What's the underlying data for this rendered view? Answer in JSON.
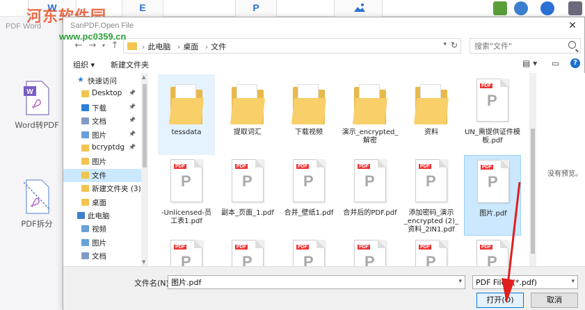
{
  "watermark": {
    "site": "河东软件园",
    "url": "www.pc0359.cn"
  },
  "background_app": {
    "brand": "PDF Word",
    "toolbar_glyphs": [
      "W",
      "E",
      "P"
    ],
    "side_items": [
      {
        "label": "Word转PDF"
      },
      {
        "label": "PDF拆分"
      }
    ]
  },
  "dialog": {
    "title": "SanPDF.Open File",
    "close": "✕",
    "address": {
      "crumbs": [
        "此电脑",
        "桌面",
        "文件"
      ],
      "search_placeholder": "搜索\"文件\""
    },
    "toolbar": {
      "organize": "组织 ▾",
      "new_folder": "新建文件夹",
      "help": "?"
    },
    "nav_pane": [
      {
        "label": "快速访问",
        "kind": "star"
      },
      {
        "label": "Desktop",
        "kind": "folder",
        "pinned": true
      },
      {
        "label": "下载",
        "kind": "download",
        "pinned": true
      },
      {
        "label": "文档",
        "kind": "doc",
        "pinned": true
      },
      {
        "label": "图片",
        "kind": "pic",
        "pinned": true
      },
      {
        "label": "bcryptdg",
        "kind": "folder",
        "pinned": true
      },
      {
        "label": "图片",
        "kind": "folder"
      },
      {
        "label": "文件",
        "kind": "folder",
        "selected": true
      },
      {
        "label": "新建文件夹 (3)",
        "kind": "folder"
      },
      {
        "label": "桌面",
        "kind": "folder"
      },
      {
        "label": "此电脑",
        "kind": "pc"
      },
      {
        "label": "视频",
        "kind": "pic"
      },
      {
        "label": "图片",
        "kind": "pic"
      },
      {
        "label": "文档",
        "kind": "doc"
      }
    ],
    "files": [
      {
        "name": "tessdata",
        "kind": "folder",
        "selected": false
      },
      {
        "name": "提取词汇",
        "kind": "folder"
      },
      {
        "name": "下载视频",
        "kind": "folder"
      },
      {
        "name": "演示_encrypted_解密",
        "kind": "folder"
      },
      {
        "name": "资料",
        "kind": "folder"
      },
      {
        "name": "UN_需提供证件模板.pdf",
        "kind": "pdf"
      },
      {
        "name": "-Unlicensed-员工表1.pdf",
        "kind": "pdf"
      },
      {
        "name": "副本_页面_1.pdf",
        "kind": "pdf"
      },
      {
        "name": "合并_壁纸1.pdf",
        "kind": "pdf"
      },
      {
        "name": "合并后的PDF.pdf",
        "kind": "pdf"
      },
      {
        "name": "添加密码_演示_encrypted (2)_资料_2IN1.pdf",
        "kind": "pdf"
      },
      {
        "name": "图片.pdf",
        "kind": "pdf",
        "selected": true
      },
      {
        "name": "",
        "kind": "pdf"
      },
      {
        "name": "",
        "kind": "pdf"
      },
      {
        "name": "",
        "kind": "pdf"
      },
      {
        "name": "",
        "kind": "pdf"
      },
      {
        "name": "",
        "kind": "pdf"
      },
      {
        "name": "",
        "kind": "pdf"
      }
    ],
    "preview_text": "没有预览。",
    "bottom": {
      "filename_label": "文件名(N):",
      "filename_value": "图片.pdf",
      "filetype_value": "PDF Files (*.pdf)",
      "open_button": "打开(O)",
      "cancel_button": "取消"
    }
  },
  "colors": {
    "accent": "#0078d7",
    "selection": "#cce8ff",
    "annotation": "#e11d1d",
    "folder": "#f8cf69"
  }
}
